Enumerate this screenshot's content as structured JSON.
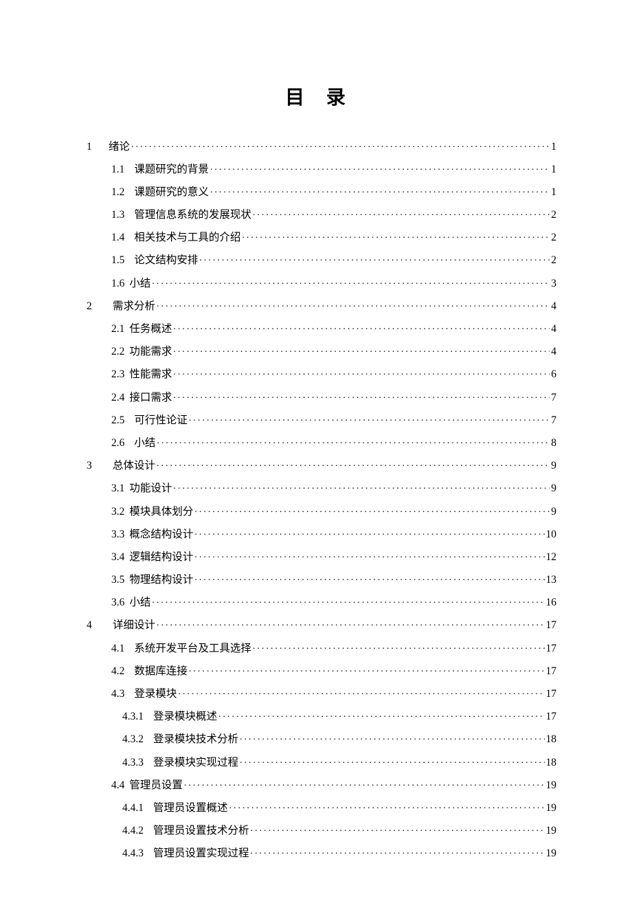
{
  "title": "目 录",
  "toc": [
    {
      "level": 0,
      "num": "1",
      "title": "绪论",
      "page": "1",
      "gap": "narrow"
    },
    {
      "level": 1,
      "num": "1.1",
      "title": "课题研究的背景",
      "page": "1",
      "gap": "wide"
    },
    {
      "level": 1,
      "num": "1.2",
      "title": "课题研究的意义",
      "page": "1",
      "gap": "wide"
    },
    {
      "level": 1,
      "num": "1.3",
      "title": "管理信息系统的发展现状",
      "page": "2",
      "gap": "wide"
    },
    {
      "level": 1,
      "num": "1.4",
      "title": "相关技术与工具的介绍",
      "page": "2",
      "gap": "wide"
    },
    {
      "level": 1,
      "num": "1.5",
      "title": "论文结构安排",
      "page": "2",
      "gap": "wide"
    },
    {
      "level": 1,
      "num": "1.6",
      "title": "小结",
      "page": "3",
      "gap": "narrow"
    },
    {
      "level": 0,
      "num": "2",
      "title": "需求分析",
      "page": "4",
      "gap": "wide"
    },
    {
      "level": 1,
      "num": "2.1",
      "title": "任务概述",
      "page": "4",
      "gap": "narrow"
    },
    {
      "level": 1,
      "num": "2.2",
      "title": "功能需求",
      "page": "4",
      "gap": "narrow"
    },
    {
      "level": 1,
      "num": "2.3",
      "title": "性能需求",
      "page": "6",
      "gap": "narrow"
    },
    {
      "level": 1,
      "num": "2.4",
      "title": "接口需求",
      "page": "7",
      "gap": "narrow"
    },
    {
      "level": 1,
      "num": "2.5",
      "title": "可行性论证",
      "page": "7",
      "gap": "wide"
    },
    {
      "level": 1,
      "num": "2.6",
      "title": "小结",
      "page": "8",
      "gap": "wide"
    },
    {
      "level": 0,
      "num": "3",
      "title": "总体设计",
      "page": "9",
      "gap": "wide"
    },
    {
      "level": 1,
      "num": "3.1",
      "title": "功能设计",
      "page": "9",
      "gap": "narrow"
    },
    {
      "level": 1,
      "num": "3.2",
      "title": "模块具体划分",
      "page": "9",
      "gap": "narrow"
    },
    {
      "level": 1,
      "num": "3.3",
      "title": "概念结构设计",
      "page": "10",
      "gap": "narrow"
    },
    {
      "level": 1,
      "num": "3.4",
      "title": "逻辑结构设计",
      "page": "12",
      "gap": "narrow"
    },
    {
      "level": 1,
      "num": "3.5",
      "title": "物理结构设计",
      "page": "13",
      "gap": "narrow"
    },
    {
      "level": 1,
      "num": "3.6",
      "title": "小结",
      "page": "16",
      "gap": "narrow"
    },
    {
      "level": 0,
      "num": "4",
      "title": "详细设计",
      "page": "17",
      "gap": "wide"
    },
    {
      "level": 1,
      "num": "4.1",
      "title": "系统开发平台及工具选择",
      "page": "17",
      "gap": "wide"
    },
    {
      "level": 1,
      "num": "4.2",
      "title": "数据库连接",
      "page": "17",
      "gap": "wide"
    },
    {
      "level": 1,
      "num": "4.3",
      "title": "登录模块",
      "page": "17",
      "gap": "wide"
    },
    {
      "level": 2,
      "num": "4.3.1",
      "title": "登录模块概述",
      "page": "17",
      "gap": "wide"
    },
    {
      "level": 2,
      "num": "4.3.2",
      "title": "登录模块技术分析",
      "page": "18",
      "gap": "wide"
    },
    {
      "level": 2,
      "num": "4.3.3",
      "title": "登录模块实现过程",
      "page": "18",
      "gap": "wide"
    },
    {
      "level": 1,
      "num": "4.4",
      "title": "管理员设置",
      "page": "19",
      "gap": "narrow"
    },
    {
      "level": 2,
      "num": "4.4.1",
      "title": "管理员设置概述",
      "page": "19",
      "gap": "wide"
    },
    {
      "level": 2,
      "num": "4.4.2",
      "title": "管理员设置技术分析",
      "page": "19",
      "gap": "wide"
    },
    {
      "level": 2,
      "num": "4.4.3",
      "title": "管理员设置实现过程",
      "page": "19",
      "gap": "wide"
    }
  ]
}
